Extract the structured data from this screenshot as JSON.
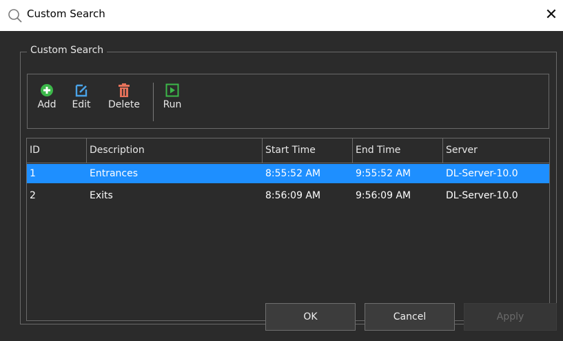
{
  "window": {
    "title": "Custom Search",
    "close_glyph": "✕"
  },
  "group": {
    "legend": "Custom Search"
  },
  "toolbar": {
    "add_label": "Add",
    "edit_label": "Edit",
    "delete_label": "Delete",
    "run_label": "Run",
    "icons": {
      "add": "plus-circle-icon",
      "edit": "edit-icon",
      "delete": "trash-icon",
      "run": "play-icon"
    },
    "icon_colors": {
      "add": "#3cb84a",
      "edit": "#4aa3e8",
      "delete": "#e8725a",
      "run": "#3cb84a"
    }
  },
  "table": {
    "columns": [
      "ID",
      "Description",
      "Start Time",
      "End Time",
      "Server"
    ],
    "rows": [
      {
        "id": "1",
        "description": "Entrances",
        "start": "8:55:52 AM",
        "end": "9:55:52 AM",
        "server": "DL-Server-10.0",
        "selected": true
      },
      {
        "id": "2",
        "description": "Exits",
        "start": "8:56:09 AM",
        "end": "9:56:09 AM",
        "server": "DL-Server-10.0",
        "selected": false
      }
    ]
  },
  "buttons": {
    "ok": "OK",
    "cancel": "Cancel",
    "apply": "Apply"
  },
  "colors": {
    "background": "#2b2b2b",
    "selection": "#1e8fff",
    "border": "#6a6a6a"
  }
}
